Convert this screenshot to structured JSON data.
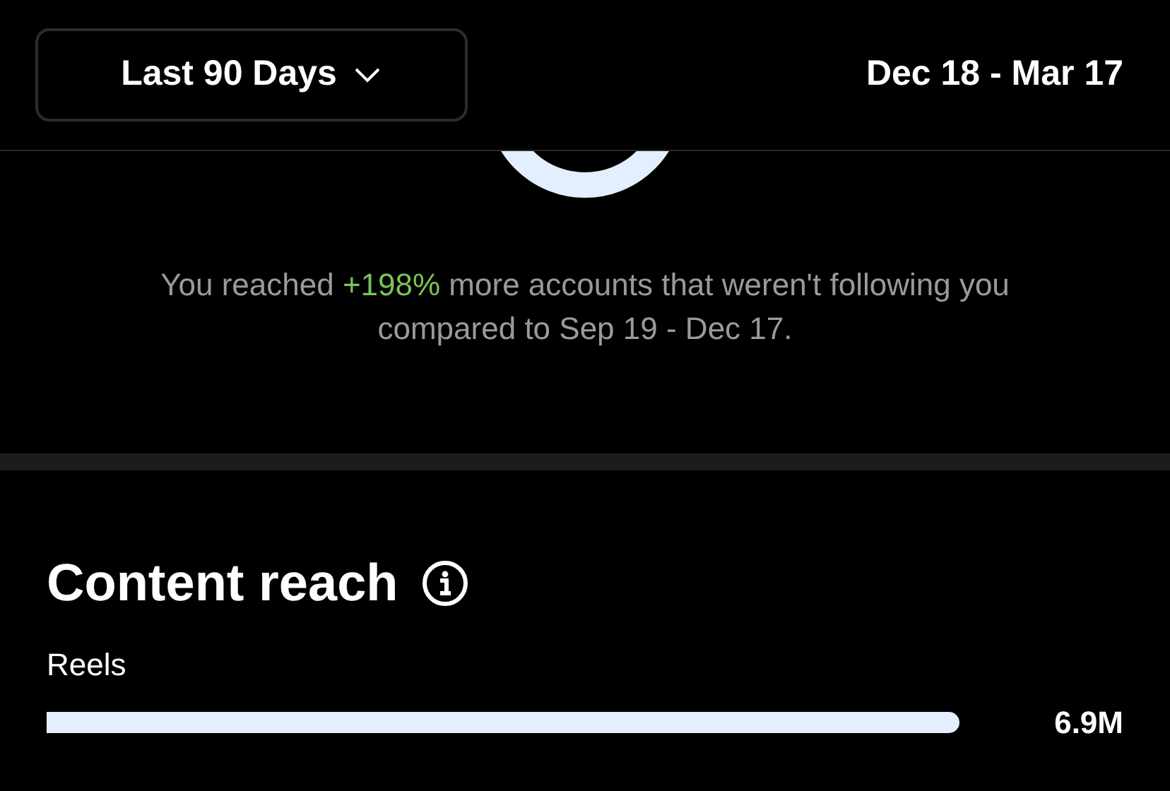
{
  "range_button": {
    "label": "Last 90 Days"
  },
  "date_range": "Dec 18 - Mar 17",
  "summary": {
    "before": "You reached ",
    "highlight": "+198%",
    "after": " more accounts that weren't following you compared to Sep 19 - Dec 17."
  },
  "content_reach": {
    "title": "Content reach",
    "items": [
      {
        "label": "Reels",
        "value": "6.9M"
      }
    ]
  }
}
